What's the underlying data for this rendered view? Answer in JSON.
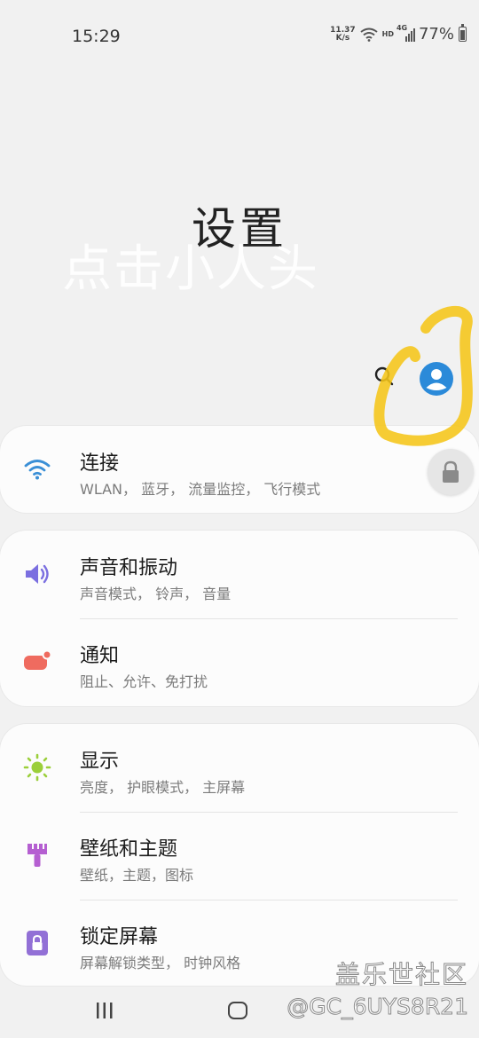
{
  "status_bar": {
    "time": "15:29",
    "net_speed_value": "11.37",
    "net_speed_unit": "K/s",
    "hd": "HD",
    "network": "4G",
    "battery_percent": "77%"
  },
  "header": {
    "title": "设置"
  },
  "overlay_hint": "点击小人头",
  "groups": [
    {
      "items": [
        {
          "title": "连接",
          "subtitle": "WLAN， 蓝牙， 流量监控， 飞行模式",
          "icon": "wifi-icon",
          "color": "#3a8fd6"
        }
      ]
    },
    {
      "items": [
        {
          "title": "声音和振动",
          "subtitle": "声音模式， 铃声， 音量",
          "icon": "speaker-icon",
          "color": "#7b6fe0"
        },
        {
          "title": "通知",
          "subtitle": "阻止、允许、免打扰",
          "icon": "notification-icon",
          "color": "#ef6b5f"
        }
      ]
    },
    {
      "items": [
        {
          "title": "显示",
          "subtitle": "亮度， 护眼模式， 主屏幕",
          "icon": "brightness-icon",
          "color": "#9bcf3a"
        },
        {
          "title": "壁纸和主题",
          "subtitle": "壁纸，主题，图标",
          "icon": "paint-brush-icon",
          "color": "#b55fd1"
        },
        {
          "title": "锁定屏幕",
          "subtitle": "屏幕解锁类型， 时钟风格",
          "icon": "lock-icon",
          "color": "#9270d6"
        }
      ]
    }
  ],
  "watermark": {
    "site": "盖乐世社区",
    "user": "@GC_6UYS8R21"
  },
  "colors": {
    "profile": "#2b8ad9",
    "scribble": "#f5c518"
  }
}
